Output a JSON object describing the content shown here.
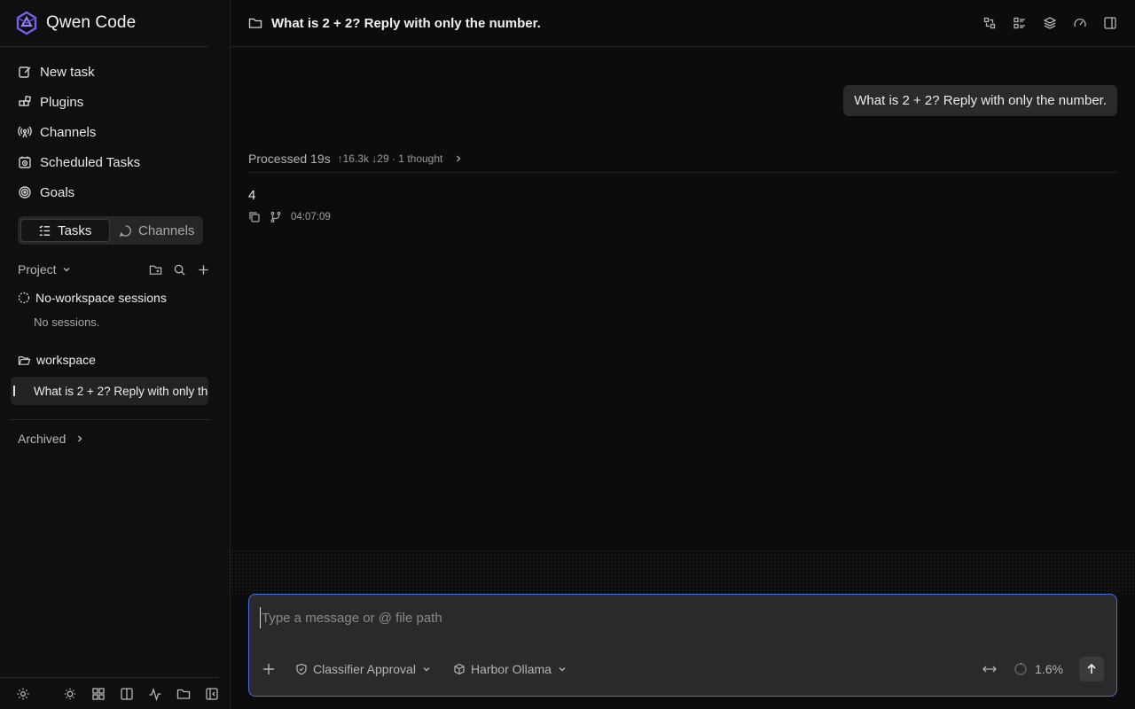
{
  "app": {
    "title": "Qwen Code",
    "accent": "#7b5cf0",
    "focus_border": "#4a6fd6"
  },
  "sidebar": {
    "nav": [
      {
        "label": "New task",
        "icon": "edit-icon"
      },
      {
        "label": "Plugins",
        "icon": "plugins-icon"
      },
      {
        "label": "Channels",
        "icon": "broadcast-icon"
      },
      {
        "label": "Scheduled Tasks",
        "icon": "calendar-clock-icon"
      },
      {
        "label": "Goals",
        "icon": "target-icon"
      }
    ],
    "tabs": [
      {
        "label": "Tasks",
        "active": true
      },
      {
        "label": "Channels",
        "active": false
      }
    ],
    "project_label": "Project",
    "groups": {
      "no_workspace": {
        "title": "No-workspace sessions",
        "empty": "No sessions."
      },
      "workspace": {
        "title": "workspace",
        "sessions": [
          "What is 2 + 2? Reply with only the number."
        ]
      }
    },
    "archived_label": "Archived"
  },
  "chat": {
    "title": "What is 2 + 2? Reply with only the number.",
    "user_message": "What is 2 + 2? Reply with only the number.",
    "processed": {
      "label": "Processed 19s",
      "stats": "↑16.3k ↓29 · 1 thought"
    },
    "answer": "4",
    "timestamp": "04:07:09"
  },
  "composer": {
    "placeholder": "Type a message or @ file path",
    "approval": "Classifier Approval",
    "model": "Harbor Ollama",
    "context_usage": "1.6%"
  }
}
